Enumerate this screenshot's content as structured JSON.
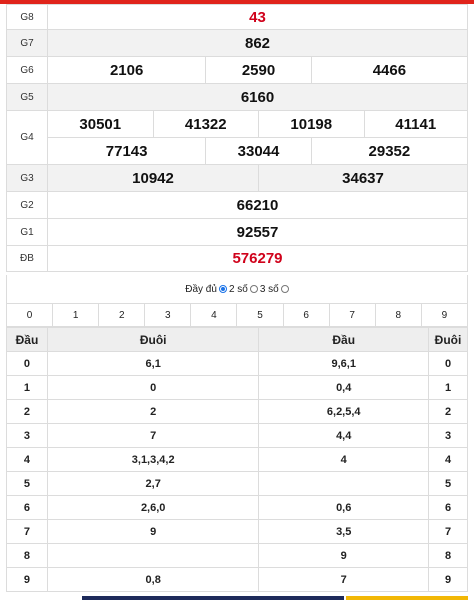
{
  "results": {
    "rows": [
      {
        "label": "G8",
        "numbers": [
          "43"
        ]
      },
      {
        "label": "G7",
        "numbers": [
          "862"
        ]
      },
      {
        "label": "G6",
        "numbers": [
          "2106",
          "2590",
          "4466"
        ]
      },
      {
        "label": "G5",
        "numbers": [
          "6160"
        ]
      },
      {
        "label": "G4",
        "numbers": [
          "30501",
          "41322",
          "10198",
          "41141",
          "77143",
          "33044",
          "29352"
        ]
      },
      {
        "label": "G3",
        "numbers": [
          "10942",
          "34637"
        ]
      },
      {
        "label": "G2",
        "numbers": [
          "66210"
        ]
      },
      {
        "label": "G1",
        "numbers": [
          "92557"
        ]
      },
      {
        "label": "ĐB",
        "numbers": [
          "576279"
        ]
      }
    ]
  },
  "options": {
    "full_label": "Đầy đủ",
    "two_label": "2 số",
    "three_label": "3 số",
    "selected": "full"
  },
  "digit_filter": [
    "0",
    "1",
    "2",
    "3",
    "4",
    "5",
    "6",
    "7",
    "8",
    "9"
  ],
  "loto": {
    "headers": [
      "Đầu",
      "Đuôi",
      "Đầu",
      "Đuôi"
    ],
    "rows": [
      {
        "dau": "0",
        "duoi": "6,1",
        "dau2": "9,6,1",
        "duoi2": "0"
      },
      {
        "dau": "1",
        "duoi": "0",
        "dau2": "0,4",
        "duoi2": "1"
      },
      {
        "dau": "2",
        "duoi": "2",
        "dau2": "6,2,5,4",
        "duoi2": "2"
      },
      {
        "dau": "3",
        "duoi": "7",
        "dau2": "4,4",
        "duoi2": "3"
      },
      {
        "dau": "4",
        "duoi": "3,1,3,4,2",
        "dau2": "4",
        "duoi2": "4"
      },
      {
        "dau": "5",
        "duoi": "2,7",
        "dau2": "",
        "duoi2": "5"
      },
      {
        "dau": "6",
        "duoi": "2,6,0",
        "dau2": "0,6",
        "duoi2": "6"
      },
      {
        "dau": "7",
        "duoi": "9",
        "dau2": "3,5",
        "duoi2": "7"
      },
      {
        "dau": "8",
        "duoi": "",
        "dau2": "9",
        "duoi2": "8"
      },
      {
        "dau": "9",
        "duoi": "0,8",
        "dau2": "7",
        "duoi2": "9"
      }
    ]
  },
  "colors": {
    "accent_red": "#d0021b",
    "radio_blue": "#1a73e8",
    "top_bar": "#e0241b"
  }
}
